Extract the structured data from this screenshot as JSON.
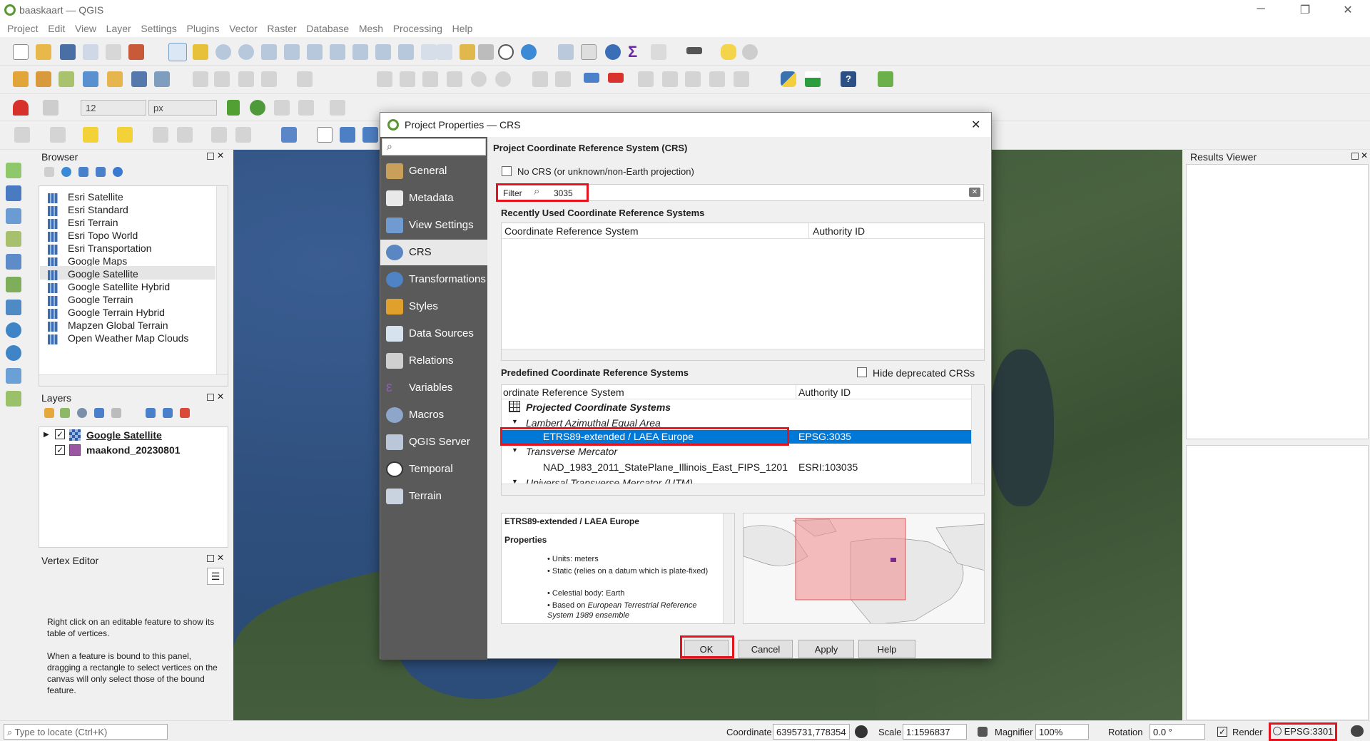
{
  "window": {
    "title": "baaskaart — QGIS"
  },
  "menu": [
    "Project",
    "Edit",
    "View",
    "Layer",
    "Settings",
    "Plugins",
    "Vector",
    "Raster",
    "Database",
    "Mesh",
    "Processing",
    "Help"
  ],
  "toolbar": {
    "font_size": "12",
    "unit": "px"
  },
  "browser": {
    "title": "Browser",
    "items": [
      "Esri Satellite",
      "Esri Standard",
      "Esri Terrain",
      "Esri Topo World",
      "Esri Transportation",
      "Google Maps",
      "Google Satellite",
      "Google Satellite Hybrid",
      "Google Terrain",
      "Google Terrain Hybrid",
      "Mapzen Global Terrain",
      "Open Weather Map Clouds"
    ],
    "selected": "Google Satellite"
  },
  "layers": {
    "title": "Layers",
    "items": [
      {
        "name": "Google Satellite",
        "checked": true,
        "bold": true,
        "underline": true
      },
      {
        "name": "maakond_20230801",
        "checked": true,
        "bold": true
      }
    ]
  },
  "vertex_editor": {
    "title": "Vertex Editor",
    "text1": "Right click on an editable feature to show its table of vertices.",
    "text2": "When a feature is bound to this panel, dragging a rectangle to select vertices on the canvas will only select those of the bound feature."
  },
  "results_viewer": {
    "title": "Results Viewer"
  },
  "dialog": {
    "title": "Project Properties — CRS",
    "search_placeholder": "",
    "nav": [
      "General",
      "Metadata",
      "View Settings",
      "CRS",
      "Transformations",
      "Styles",
      "Data Sources",
      "Relations",
      "Variables",
      "Macros",
      "QGIS Server",
      "Temporal",
      "Terrain"
    ],
    "nav_selected": "CRS",
    "section_title": "Project Coordinate Reference System (CRS)",
    "no_crs_label": "No CRS (or unknown/non-Earth projection)",
    "filter_label": "Filter",
    "filter_value": "3035",
    "recent_title": "Recently Used Coordinate Reference Systems",
    "recent_columns": [
      "Coordinate Reference System",
      "Authority ID"
    ],
    "predefined_title": "Predefined Coordinate Reference Systems",
    "hide_deprecated": "Hide deprecated CRSs",
    "predefined_columns": [
      "ordinate Reference System",
      "Authority ID"
    ],
    "tree": {
      "root": "Projected Coordinate Systems",
      "group1": "Lambert Azimuthal Equal Area",
      "selected_name": "ETRS89-extended / LAEA Europe",
      "selected_id": "EPSG:3035",
      "group2": "Transverse Mercator",
      "row2_name": "NAD_1983_2011_StatePlane_Illinois_East_FIPS_1201",
      "row2_id": "ESRI:103035",
      "group3": "Universal Transverse Mercator (UTM)"
    },
    "details": {
      "name": "ETRS89-extended / LAEA Europe",
      "properties_label": "Properties",
      "units": "Units: meters",
      "static": "Static (relies on a datum which is plate-fixed)",
      "body": "Celestial body: Earth",
      "based_prefix": "Based on ",
      "based_on": "European Terrestrial Reference System 1989 ensemble"
    },
    "buttons": {
      "ok": "OK",
      "cancel": "Cancel",
      "apply": "Apply",
      "help": "Help"
    }
  },
  "statusbar": {
    "locate_placeholder": "Type to locate (Ctrl+K)",
    "coordinate_label": "Coordinate",
    "coordinate": "6395731,778354",
    "scale_label": "Scale",
    "scale": "1:1596837",
    "magnifier_label": "Magnifier",
    "magnifier": "100%",
    "rotation_label": "Rotation",
    "rotation": "0.0 °",
    "render_label": "Render",
    "crs": "EPSG:3301"
  },
  "colors": {
    "accent_red": "#e5131e",
    "selection_blue": "#0078d7",
    "nav_bg": "#5a5a5a"
  }
}
